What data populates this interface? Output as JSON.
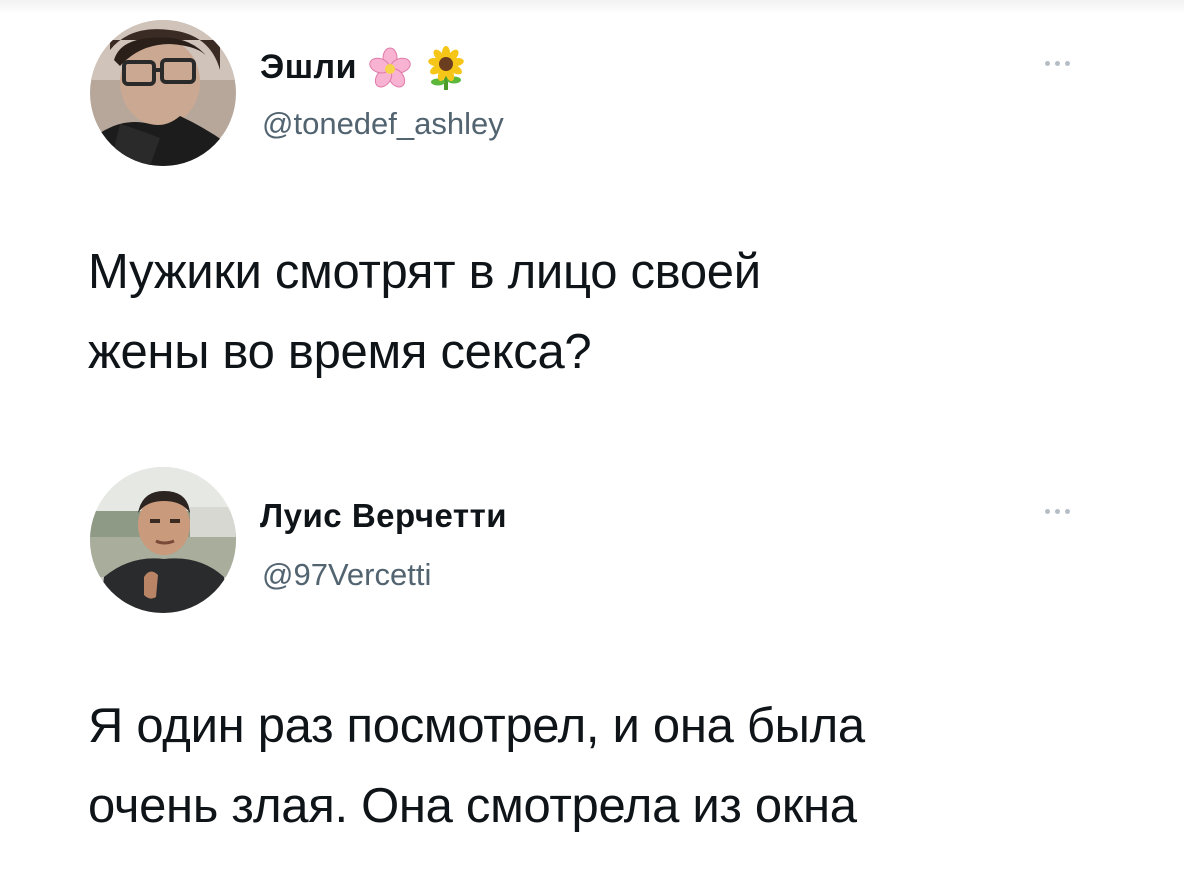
{
  "tweets": [
    {
      "author": {
        "display_name": "Эшли",
        "emojis": [
          "cherry-blossom-emoji",
          "sunflower-emoji"
        ],
        "handle": "@tonedef_ashley",
        "avatar": "user-avatar-photo"
      },
      "more_icon": "more-horizontal-icon",
      "text_lines": [
        "Мужики смотрят в лицо своей",
        "жены во время секса?"
      ]
    },
    {
      "author": {
        "display_name": "Луис Верчетти",
        "handle": "@97Vercetti",
        "avatar": "user-avatar-photo"
      },
      "more_icon": "more-horizontal-icon",
      "text_lines": [
        "Я один раз посмотрел, и она была",
        "очень злая. Она смотрела из окна"
      ]
    }
  ],
  "colors": {
    "text": "#0f1419",
    "handle": "#536471",
    "more_dots": "#b6bec5",
    "background": "#ffffff"
  }
}
